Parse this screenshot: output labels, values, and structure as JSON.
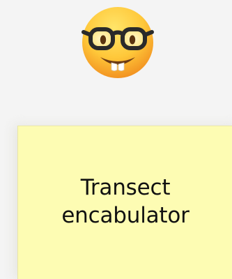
{
  "emoji": {
    "icon": "nerd-face-icon",
    "colors": {
      "face_top": "#ffd84a",
      "face_bottom": "#f28a1c",
      "glasses": "#2a2a2a",
      "mouth": "#6b3a13",
      "teeth": "#ffffff"
    }
  },
  "note": {
    "lines": [
      "Transect",
      "encabulator"
    ],
    "background": "#fdfcb3"
  }
}
